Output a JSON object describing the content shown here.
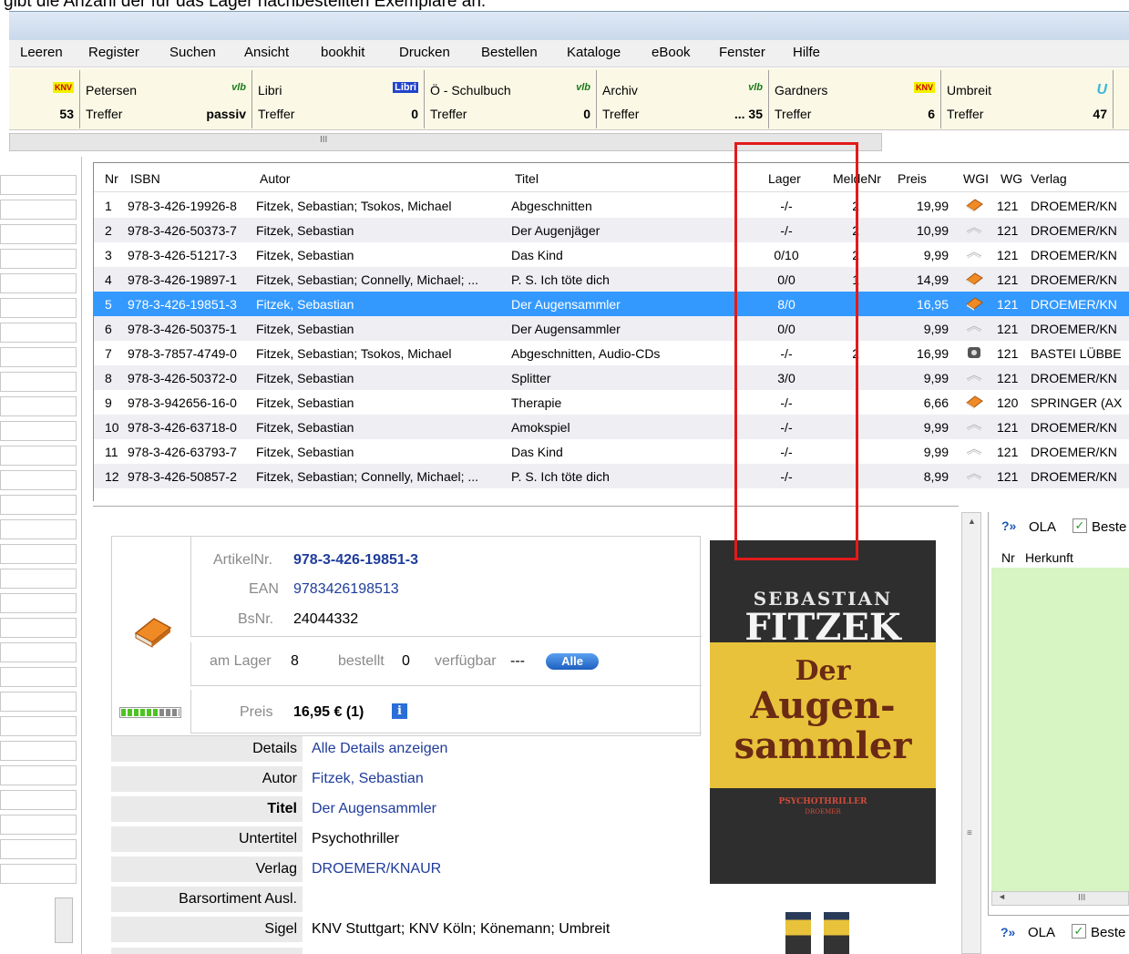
{
  "caption": "gibt die Anzahl der für das Lager nachbestellten Exemplare an.",
  "menu": [
    "Leeren",
    "Register",
    "Suchen",
    "Ansicht",
    "bookhit",
    "Drucken",
    "Bestellen",
    "Kataloge",
    "eBook",
    "Fenster",
    "Hilfe"
  ],
  "suppliers": [
    {
      "name": "",
      "logo": "KNV",
      "label": "",
      "count": "53"
    },
    {
      "name": "Petersen",
      "logo": "vlb",
      "label": "Treffer",
      "count": "passiv"
    },
    {
      "name": "Libri",
      "logo": "Libri",
      "label": "Treffer",
      "count": "0"
    },
    {
      "name": "Ö - Schulbuch",
      "logo": "vlb",
      "label": "Treffer",
      "count": "0"
    },
    {
      "name": "Archiv",
      "logo": "vlb",
      "label": "Treffer",
      "count": "... 35"
    },
    {
      "name": "Gardners",
      "logo": "KNV",
      "label": "Treffer",
      "count": "6"
    },
    {
      "name": "Umbreit",
      "logo": "U",
      "label": "Treffer",
      "count": "47"
    }
  ],
  "scroll_mark": "III",
  "grid": {
    "headers": {
      "nr": "Nr",
      "isbn": "ISBN",
      "autor": "Autor",
      "titel": "Titel",
      "lager": "Lager",
      "meldenr": "MeldeNr",
      "preis": "Preis",
      "wgi": "WGI",
      "wg": "WG",
      "verlag": "Verlag"
    },
    "rows": [
      {
        "nr": "1",
        "isbn": "978-3-426-19926-8",
        "autor": "Fitzek, Sebastian; Tsokos, Michael",
        "titel": "Abgeschnitten",
        "lager": "-/-",
        "meldenr": "2",
        "preis": "19,99",
        "wgi": "book",
        "wg": "121",
        "verlag": "DROEMER/KN"
      },
      {
        "nr": "2",
        "isbn": "978-3-426-50373-7",
        "autor": "Fitzek, Sebastian",
        "titel": "Der Augenjäger",
        "lager": "-/-",
        "meldenr": "2",
        "preis": "10,99",
        "wgi": "ebook",
        "wg": "121",
        "verlag": "DROEMER/KN"
      },
      {
        "nr": "3",
        "isbn": "978-3-426-51217-3",
        "autor": "Fitzek, Sebastian",
        "titel": "Das Kind",
        "lager": "0/10",
        "meldenr": "2",
        "preis": "9,99",
        "wgi": "ebook",
        "wg": "121",
        "verlag": "DROEMER/KN"
      },
      {
        "nr": "4",
        "isbn": "978-3-426-19897-1",
        "autor": "Fitzek, Sebastian; Connelly, Michael; ...",
        "titel": "P. S. Ich töte dich",
        "lager": "0/0",
        "meldenr": "1",
        "preis": "14,99",
        "wgi": "book",
        "wg": "121",
        "verlag": "DROEMER/KN"
      },
      {
        "nr": "5",
        "isbn": "978-3-426-19851-3",
        "autor": "Fitzek, Sebastian",
        "titel": "Der Augensammler",
        "lager": "8/0",
        "meldenr": "",
        "preis": "16,95",
        "wgi": "book",
        "wg": "121",
        "verlag": "DROEMER/KN"
      },
      {
        "nr": "6",
        "isbn": "978-3-426-50375-1",
        "autor": "Fitzek, Sebastian",
        "titel": "Der Augensammler",
        "lager": "0/0",
        "meldenr": "",
        "preis": "9,99",
        "wgi": "ebook",
        "wg": "121",
        "verlag": "DROEMER/KN"
      },
      {
        "nr": "7",
        "isbn": "978-3-7857-4749-0",
        "autor": "Fitzek, Sebastian; Tsokos, Michael",
        "titel": "Abgeschnitten, Audio-CDs",
        "lager": "-/-",
        "meldenr": "2",
        "preis": "16,99",
        "wgi": "audio",
        "wg": "121",
        "verlag": "BASTEI LÜBBE"
      },
      {
        "nr": "8",
        "isbn": "978-3-426-50372-0",
        "autor": "Fitzek, Sebastian",
        "titel": "Splitter",
        "lager": "3/0",
        "meldenr": "",
        "preis": "9,99",
        "wgi": "ebook",
        "wg": "121",
        "verlag": "DROEMER/KN"
      },
      {
        "nr": "9",
        "isbn": "978-3-942656-16-0",
        "autor": "Fitzek, Sebastian",
        "titel": "Therapie",
        "lager": "-/-",
        "meldenr": "",
        "preis": "6,66",
        "wgi": "book",
        "wg": "120",
        "verlag": "SPRINGER (AX"
      },
      {
        "nr": "10",
        "isbn": "978-3-426-63718-0",
        "autor": "Fitzek, Sebastian",
        "titel": "Amokspiel",
        "lager": "-/-",
        "meldenr": "",
        "preis": "9,99",
        "wgi": "ebook",
        "wg": "121",
        "verlag": "DROEMER/KN"
      },
      {
        "nr": "11",
        "isbn": "978-3-426-63793-7",
        "autor": "Fitzek, Sebastian",
        "titel": "Das Kind",
        "lager": "-/-",
        "meldenr": "",
        "preis": "9,99",
        "wgi": "ebook",
        "wg": "121",
        "verlag": "DROEMER/KN"
      },
      {
        "nr": "12",
        "isbn": "978-3-426-50857-2",
        "autor": "Fitzek, Sebastian; Connelly, Michael; ...",
        "titel": "P. S. Ich töte dich",
        "lager": "-/-",
        "meldenr": "",
        "preis": "8,99",
        "wgi": "ebook",
        "wg": "121",
        "verlag": "DROEMER/KN"
      }
    ]
  },
  "detail": {
    "artikel_label": "ArtikelNr.",
    "artikel": "978-3-426-19851-3",
    "ean_label": "EAN",
    "ean": "9783426198513",
    "bsnr_label": "BsNr.",
    "bsnr": "24044332",
    "lager_label": "am Lager",
    "lager": "8",
    "bestellt_label": "bestellt",
    "bestellt": "0",
    "verfuegbar_label": "verfügbar",
    "verfuegbar": "---",
    "alle": "Alle",
    "preis_label": "Preis",
    "preis": "16,95 € (1)",
    "rows": [
      {
        "label": "Details",
        "value": "Alle Details anzeigen"
      },
      {
        "label": "Autor",
        "value": "Fitzek, Sebastian"
      },
      {
        "label": "Titel",
        "value": "Der Augensammler"
      },
      {
        "label": "Untertitel",
        "value": "Psychothriller"
      },
      {
        "label": "Verlag",
        "value": "DROEMER/KNAUR"
      },
      {
        "label": "Barsortiment Ausl.",
        "value": ""
      },
      {
        "label": "Sigel",
        "value": "KNV Stuttgart; KNV Köln; Könemann; Umbreit"
      }
    ]
  },
  "cover": {
    "author_first": "SEBASTIAN",
    "author_last": "FITZEK",
    "title1": "Der",
    "title2": "Augen-",
    "title3": "sammler",
    "sub": "PSYCHOTHRILLER",
    "publisher": "DROEMER"
  },
  "right_panel": {
    "ola": "OLA",
    "bestellen": "Beste",
    "nr": "Nr",
    "herkunft": "Herkunft",
    "scroll_mark": "III"
  }
}
